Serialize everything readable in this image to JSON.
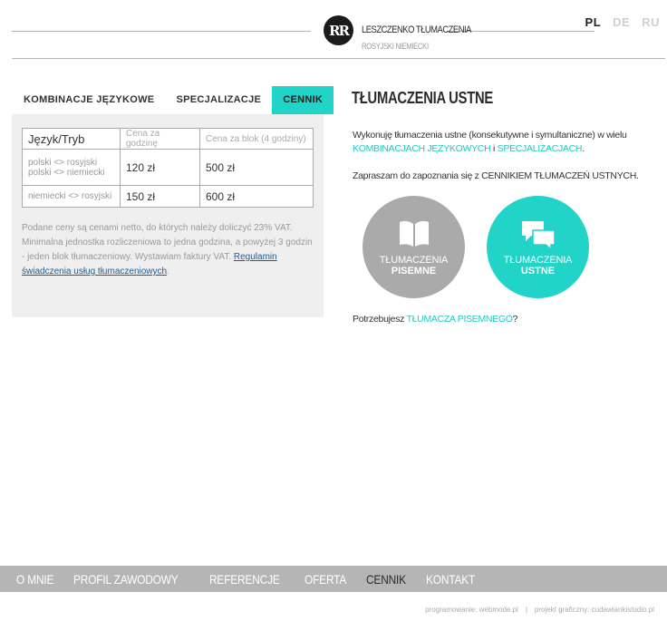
{
  "header": {
    "logo_text": "RR",
    "brand_title": "Leszczenko Tłumaczenia",
    "brand_subtitle": "Rosyjski Niemiecki",
    "languages": [
      "PL",
      "DE",
      "RU"
    ]
  },
  "tabs": [
    "Kombinacje językowe",
    "Specjalizacje",
    "Cennik"
  ],
  "price_table": {
    "headers": [
      "Język/Tryb",
      "Cena za godzinę",
      "Cena za blok (4 godziny)"
    ],
    "rows": [
      {
        "pair_line1": "polski <> rosyjski",
        "pair_line2": "polski <> niemiecki",
        "per_hour": "120 zł",
        "per_block": "500 zł"
      },
      {
        "pair_line1": "niemiecki <> rosyjski",
        "per_hour": "150 zł",
        "per_block": "600 zł"
      }
    ]
  },
  "note": {
    "text": "Podane ceny są cenami netto, do których należy doliczyć 23% VAT. Minimalna jednostka rozliczeniowa to jedna godzina, a powyżej 3 godzin - jeden blok tłumaczeniowy. Wystawiam faktury VAT.",
    "link": "Regulamin świadczenia usług tłumaczeniowych",
    "link_suffix": "."
  },
  "main": {
    "heading": "Tłumaczenia ustne",
    "p1_before": "Wykonuję tłumaczenia ustne (konsekutywne i symultaniczne) w wielu ",
    "p1_link1": "kombinacjach językowych",
    "p1_mid": " i ",
    "p1_link2": "specjalizacjach",
    "p1_after": ".",
    "p2_before": "Zapraszam do zapoznania się z ",
    "p2_emph": "CENNIKIEM TŁUMACZEŃ USTNYCH",
    "p2_after": ".",
    "circle1_line1": "Tłumaczenia",
    "circle1_line2": "Pisemne",
    "circle2_line1": "Tłumaczenia",
    "circle2_line2": "Ustne",
    "p3_before": "Potrzebujesz ",
    "p3_link": "tłumacza pisemnego",
    "p3_after": "?"
  },
  "footer": {
    "nav": [
      "O mnie",
      "Profil zawodowy",
      "Referencje",
      "Oferta",
      "Cennik",
      "Kontakt"
    ],
    "active_nav": "Cennik",
    "credit1": "programowanie: webmode.pl",
    "separator": "|",
    "credit2": "projekt graficzny: cudawiankistudio.pl"
  },
  "colors": {
    "accent": "#22d3c8",
    "gray_circle": "#aaaaaa",
    "footer_bar": "#b5b5b5"
  },
  "icons": [
    "book-icon",
    "speech-bubbles-icon"
  ]
}
